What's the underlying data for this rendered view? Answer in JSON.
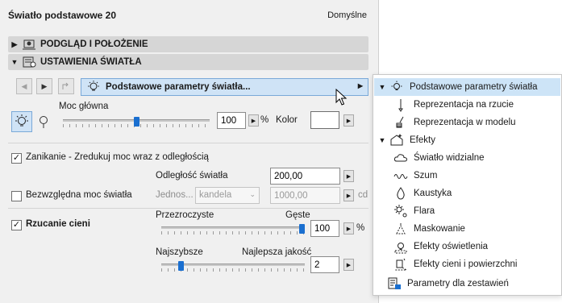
{
  "panel": {
    "title": "Światło podstawowe 20",
    "default_label": "Domyślne",
    "sections": [
      {
        "label": "PODGLĄD I POŁOŻENIE",
        "expanded": false
      },
      {
        "label": "USTAWIENIA ŚWIATŁA",
        "expanded": true
      }
    ],
    "dropdown_label": "Podstawowe parametry światła...",
    "main_power_label": "Moc główna",
    "main_power_value": "100",
    "main_power_level": 0.5,
    "percent_sign": "%",
    "color_label": "Kolor",
    "falloff_label": "Zanikanie - Zredukuj moc wraz z odległością",
    "falloff_checked": true,
    "distance_label": "Odległość światła",
    "distance_value": "200,00",
    "absolute_label": "Bezwzględna moc światła",
    "absolute_checked": false,
    "units_label": "Jednos...",
    "units_value": "kandela",
    "absolute_value": "1000,00",
    "absolute_unit": "cd",
    "shadows_label": "Rzucanie cieni",
    "shadows_checked": true,
    "transparent_label": "Przezroczyste",
    "dense_label": "Gęste",
    "density_value": "100",
    "density_level": 1.0,
    "fastest_label": "Najszybsze",
    "best_label": "Najlepsza jakość",
    "quality_value": "2",
    "quality_level": 0.12
  },
  "menu": {
    "items": [
      {
        "label": "Podstawowe parametry światła",
        "icon": "bulb-icon",
        "selected": true
      },
      {
        "label": "Reprezentacja na rzucie",
        "icon": "pen-icon"
      },
      {
        "label": "Reprezentacja w modelu",
        "icon": "brush-icon"
      },
      {
        "label": "Efekty",
        "icon": "effects-icon",
        "expanded": true
      },
      {
        "label": "Światło widzialne",
        "icon": "cloud-icon"
      },
      {
        "label": "Szum",
        "icon": "wave-icon"
      },
      {
        "label": "Kaustyka",
        "icon": "drop-icon"
      },
      {
        "label": "Flara",
        "icon": "flare-icon"
      },
      {
        "label": "Maskowanie",
        "icon": "mask-icon"
      },
      {
        "label": "Efekty oświetlenia",
        "icon": "bulb-dashed-icon"
      },
      {
        "label": "Efekty cieni i powierzchni",
        "icon": "shadow-surface-icon"
      },
      {
        "label": "Parametry dla zestawień",
        "icon": "schedule-icon"
      }
    ]
  },
  "colors": {
    "accent": "#1a6fd0",
    "selected_bg": "#cde4f7",
    "section_bg": "#d6d6d6"
  }
}
